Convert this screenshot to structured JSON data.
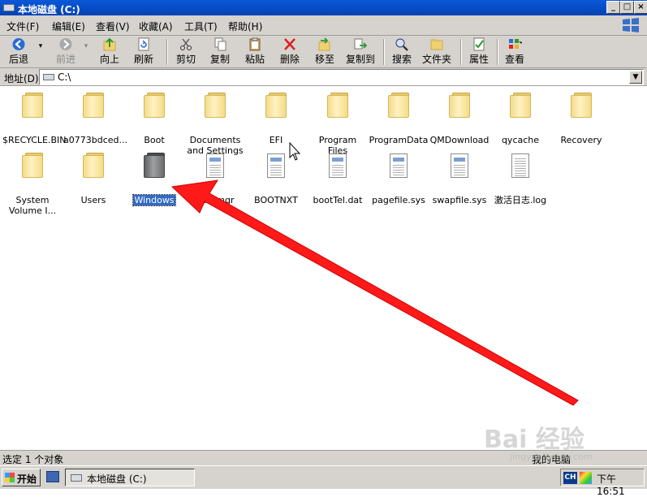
{
  "window": {
    "title": "本地磁盘 (C:)"
  },
  "menu": [
    "文件(F)",
    "编辑(E)",
    "查看(V)",
    "收藏(A)",
    "工具(T)",
    "帮助(H)"
  ],
  "toolbar": {
    "back": "后退",
    "forward": "前进",
    "up": "向上",
    "refresh": "刷新",
    "cut": "剪切",
    "copy": "复制",
    "paste": "粘贴",
    "delete": "删除",
    "move_to": "移至",
    "copy_to": "复制到",
    "search": "搜索",
    "folders": "文件夹",
    "properties": "属性",
    "views": "查看"
  },
  "address": {
    "label": "地址(D)",
    "value": "C:\\"
  },
  "files": [
    {
      "name": "$RECYCLE.BIN",
      "type": "folder"
    },
    {
      "name": "a0773bdced...",
      "type": "folder"
    },
    {
      "name": "Boot",
      "type": "folder"
    },
    {
      "name": "Documents and Settings",
      "type": "folder"
    },
    {
      "name": "EFI",
      "type": "folder"
    },
    {
      "name": "Program Files",
      "type": "folder"
    },
    {
      "name": "ProgramData",
      "type": "folder"
    },
    {
      "name": "QMDownload",
      "type": "folder"
    },
    {
      "name": "qycache",
      "type": "folder"
    },
    {
      "name": "Recovery",
      "type": "folder"
    },
    {
      "name": "System Volume I...",
      "type": "folder"
    },
    {
      "name": "Users",
      "type": "folder"
    },
    {
      "name": "Windows",
      "type": "folder-dark",
      "selected": true
    },
    {
      "name": "bootmgr",
      "type": "file"
    },
    {
      "name": "BOOTNXT",
      "type": "file"
    },
    {
      "name": "bootTel.dat",
      "type": "file"
    },
    {
      "name": "pagefile.sys",
      "type": "file"
    },
    {
      "name": "swapfile.sys",
      "type": "file"
    },
    {
      "name": "激活日志.log",
      "type": "text"
    }
  ],
  "status": {
    "left": "选定 1 个对象",
    "right": "我的电脑"
  },
  "taskbar": {
    "start": "开始",
    "task": "本地磁盘 (C:)",
    "lang": "CH",
    "clock": "下午 16:51"
  },
  "watermark": {
    "brand": "Bai 经验",
    "url": "jingyan.baidu.com"
  }
}
